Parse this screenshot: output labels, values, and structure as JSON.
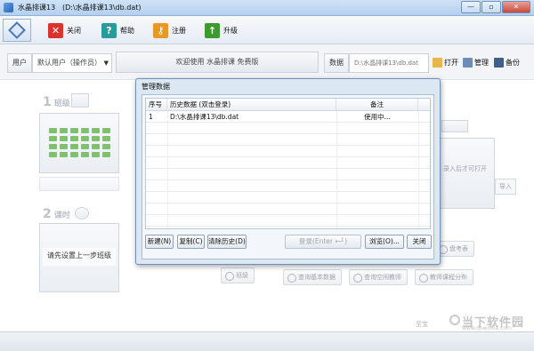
{
  "window": {
    "title": "水晶排课13",
    "path": "(D:\\水晶排课13\\db.dat)",
    "buttons": [
      "—",
      "▫",
      "✕"
    ]
  },
  "toolbar": {
    "items": [
      {
        "label": "关闭",
        "icon": "close-x-icon",
        "color": "#d9342b"
      },
      {
        "label": "帮助",
        "icon": "help-question-icon",
        "color": "#2a9b9b"
      },
      {
        "label": "注册",
        "icon": "key-icon",
        "color": "#e79a23"
      },
      {
        "label": "升级",
        "icon": "upgrade-arrow-icon",
        "color": "#3d9a2f"
      }
    ]
  },
  "userbar": {
    "user_label": "用户",
    "user_value": "默认用户（操作员）",
    "welcome": "欢迎使用 水晶排课 免费版",
    "data_label": "数据",
    "data_path": "D:\\水晶排课13\\db.dat",
    "open": "打开",
    "manage": "管理",
    "backup": "备份"
  },
  "background": {
    "step1": "班级",
    "step1_num": "1",
    "step2": "课时",
    "step2_num": "2",
    "hint": "请先设置上一步班级",
    "import": "导入",
    "side_note": [
      "录入后才可打开"
    ],
    "pills": [
      "盘考表",
      "查询基本数据",
      "查询空闲教师",
      "教师课程分布",
      "班级"
    ],
    "credit": "至宝"
  },
  "watermark": {
    "main": "当下软件园",
    "sub": "www.downxia.com"
  },
  "dialog": {
    "title": "管理数据",
    "columns": [
      "序号",
      "历史数据 (双击登录)",
      "备注"
    ],
    "rows": [
      {
        "no": "1",
        "path": "D:\\水晶排课13\\db.dat",
        "note": "使用中..."
      }
    ],
    "buttons": {
      "new": "新建(N)",
      "copy": "复制(C)",
      "clear": "清除历史(D)",
      "login": "登录(Enter ←┘)",
      "browse": "浏览(O)...",
      "close": "关闭"
    }
  }
}
